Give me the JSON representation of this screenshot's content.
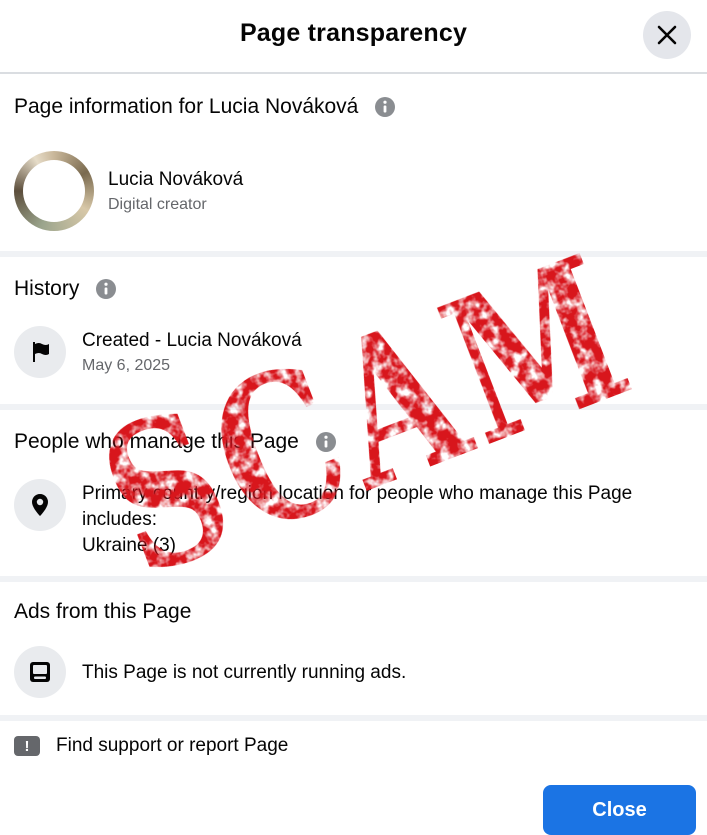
{
  "header": {
    "title": "Page transparency"
  },
  "page_info": {
    "title": "Page information for Lucia Nováková",
    "name": "Lucia Nováková",
    "category": "Digital creator"
  },
  "history": {
    "title": "History",
    "event": "Created - Lucia Nováková",
    "date": "May 6, 2025"
  },
  "managers": {
    "title": "People who manage this Page",
    "line1": "Primary country/region location for people who manage this Page",
    "line2": "includes:",
    "country": "Ukraine (3)"
  },
  "ads": {
    "title": "Ads from this Page",
    "text": "This Page is not currently running ads."
  },
  "report": {
    "icon_text": "!",
    "label": "Find support or report Page"
  },
  "footer": {
    "close_label": "Close"
  },
  "overlay": {
    "stamp_text": "SCAM",
    "color": "#d8141c"
  },
  "colors": {
    "accent": "#1b74e4",
    "secondary_text": "#65676b",
    "divider": "#f0f2f5"
  }
}
